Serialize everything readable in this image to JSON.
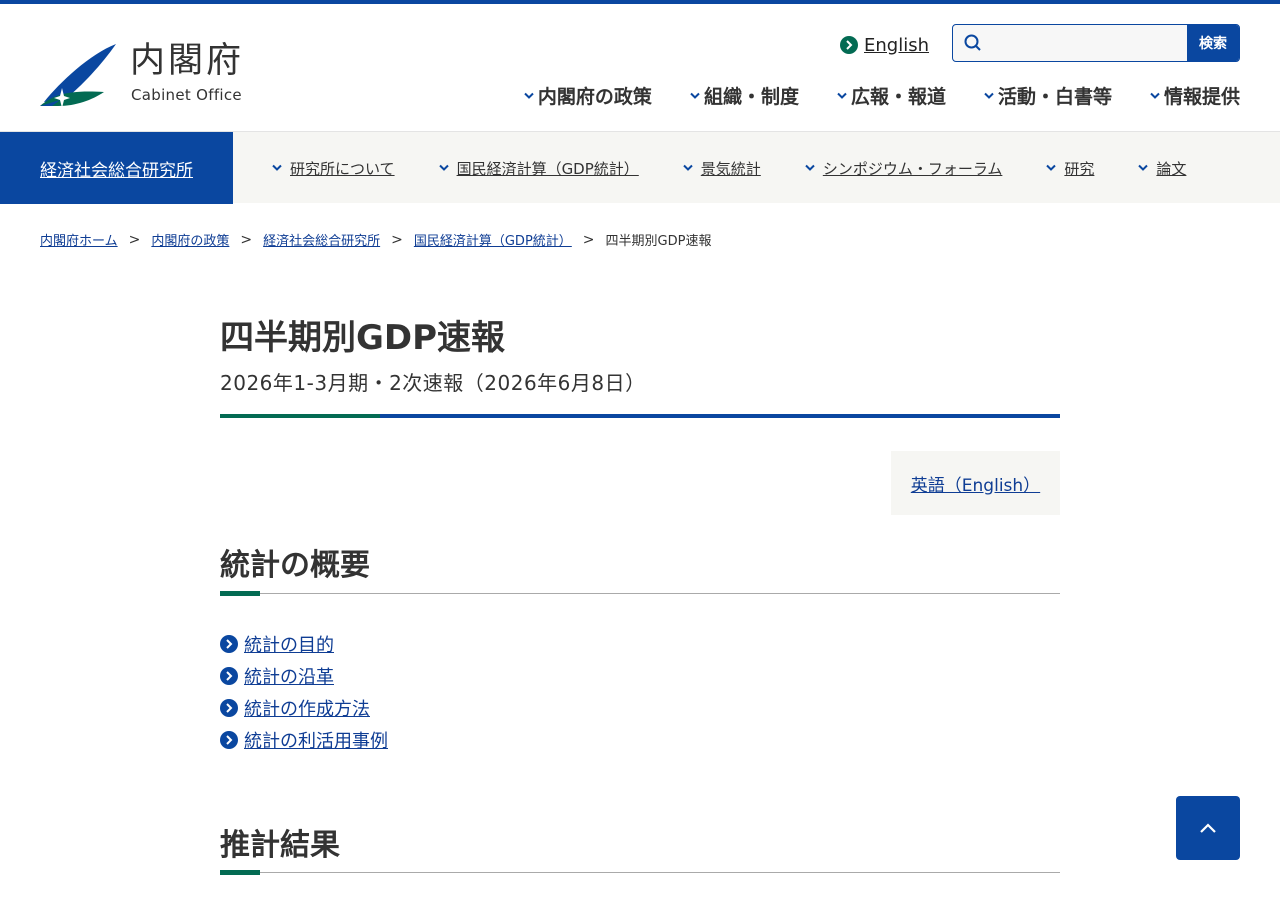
{
  "header": {
    "logo_text": "内閣府",
    "logo_sub": "Cabinet Office",
    "english_link": "English",
    "search": {
      "placeholder": "",
      "button_label": "検索"
    },
    "gnav": [
      {
        "label": "内閣府の政策"
      },
      {
        "label": "組織・制度"
      },
      {
        "label": "広報・報道"
      },
      {
        "label": "活動・白書等"
      },
      {
        "label": "情報提供"
      }
    ]
  },
  "subnav": {
    "title": "経済社会総合研究所",
    "items": [
      {
        "label": "研究所について"
      },
      {
        "label": "国民経済計算（GDP統計）"
      },
      {
        "label": "景気統計"
      },
      {
        "label": "シンポジウム・フォーラム"
      },
      {
        "label": "研究"
      },
      {
        "label": "論文"
      }
    ]
  },
  "breadcrumb": {
    "links": [
      "内閣府ホーム",
      "内閣府の政策",
      "経済社会総合研究所",
      "国民経済計算（GDP統計）"
    ],
    "separator": ">",
    "current": "四半期別GDP速報"
  },
  "main": {
    "title": "四半期別GDP速報",
    "subtitle": "2026年1-3月期・2次速報（2026年6月8日）",
    "english_button": "英語（English）",
    "sections": [
      {
        "heading": "統計の概要",
        "links": [
          "統計の目的",
          "統計の沿革",
          "統計の作成方法",
          "統計の利活用事例"
        ]
      },
      {
        "heading": "推計結果"
      }
    ]
  },
  "colors": {
    "brand_blue": "#0a47a0",
    "brand_green": "#036b53",
    "subnav_bg": "#f6f6f3"
  },
  "icons": {
    "back_to_top": "chevron-up-icon",
    "search": "search-icon",
    "nav": "chevron-down-icon",
    "link_bullet": "circle-chevron-right-icon"
  }
}
